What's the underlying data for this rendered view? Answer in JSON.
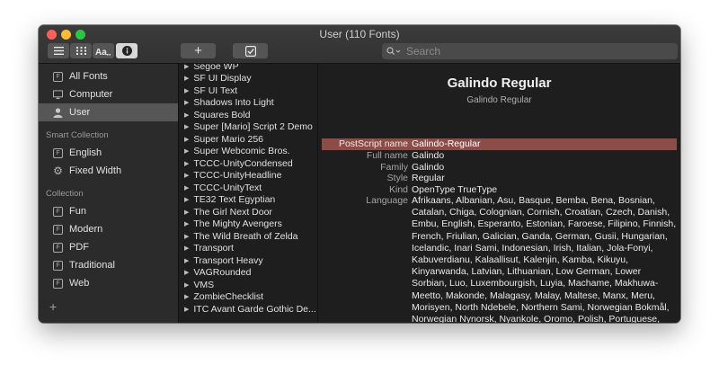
{
  "window": {
    "title": "User (110 Fonts)"
  },
  "toolbar": {
    "add_label": "+",
    "search_placeholder": "Search"
  },
  "sidebar": {
    "libraries": [
      {
        "label": "All Fonts",
        "icon": "font-book-icon",
        "selected": false
      },
      {
        "label": "Computer",
        "icon": "computer-icon",
        "selected": false
      },
      {
        "label": "User",
        "icon": "user-icon",
        "selected": true
      }
    ],
    "smart_header": "Smart Collection",
    "smart": [
      {
        "label": "English",
        "icon": "font-book-icon"
      },
      {
        "label": "Fixed Width",
        "icon": "gear-icon"
      }
    ],
    "collection_header": "Collection",
    "collections": [
      {
        "label": "Fun"
      },
      {
        "label": "Modern"
      },
      {
        "label": "PDF"
      },
      {
        "label": "Traditional"
      },
      {
        "label": "Web"
      }
    ],
    "add_label": "+"
  },
  "fonts": [
    "Segoe WP",
    "SF UI Display",
    "SF UI Text",
    "Shadows Into Light",
    "Squares Bold",
    "Super [Mario] Script 2 Demo",
    "Super Mario 256",
    "Super Webcomic Bros.",
    "TCCC-UnityCondensed",
    "TCCC-UnityHeadline",
    "TCCC-UnityText",
    "TE32 Text Egyptian",
    "The Girl Next Door",
    "The Mighty Avengers",
    "The Wild Breath of Zelda",
    "Transport",
    "Transport Heavy",
    "VAGRounded",
    "VMS",
    "ZombieChecklist",
    "ITC Avant Garde Gothic De..."
  ],
  "detail": {
    "title": "Galindo Regular",
    "subtitle": "Galindo Regular",
    "rows": [
      {
        "key": "PostScript name",
        "value": "Galindo-Regular"
      },
      {
        "key": "Full name",
        "value": "Galindo"
      },
      {
        "key": "Family",
        "value": "Galindo"
      },
      {
        "key": "Style",
        "value": "Regular"
      },
      {
        "key": "Kind",
        "value": "OpenType TrueType"
      }
    ],
    "language_key": "Language",
    "language_value": "Afrikaans, Albanian, Asu, Basque, Bemba, Bena, Bosnian, Catalan, Chiga, Colognian, Cornish, Croatian, Czech, Danish, Embu, English, Esperanto, Estonian, Faroese, Filipino, Finnish, French, Friulian, Galician, Ganda, German, Gusii, Hungarian, Icelandic, Inari Sami, Indonesian, Irish, Italian, Jola-Fonyi, Kabuverdianu, Kalaallisut, Kalenjin, Kamba, Kikuyu, Kinyarwanda, Latvian, Lithuanian, Low German, Lower Sorbian, Luo, Luxembourgish, Luyia, Machame, Makhuwa-Meetto, Makonde, Malagasy, Malay, Maltese, Manx, Meru, Morisyen, North Ndebele, Northern Sami, Norwegian Bokmål, Norwegian Nynorsk, Nyankole, Oromo, Polish, Portuguese, Romansh, Rombo, Rundi, Rwa, Samburu, Sango, Sangu, Scottish Gaelic, Sena, Shambala, Shona, Slovak, Slovenian, Soga, Somali, Spanish, Swahili, Swedish, Swiss German, Taita, Teso,"
  },
  "colors": {
    "highlight": "#8e4c47",
    "sidebar_selected": "#565656",
    "close": "#fe5f57",
    "minimize": "#febc2e",
    "maximize": "#28c840"
  }
}
